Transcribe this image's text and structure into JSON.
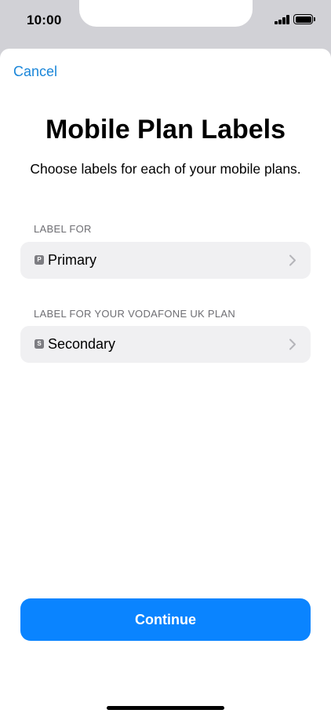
{
  "status_bar": {
    "time": "10:00",
    "icons": [
      "signal-icon",
      "battery-icon"
    ]
  },
  "sheet": {
    "cancel_label": "Cancel",
    "title": "Mobile Plan Labels",
    "subtitle": "Choose labels for each of your mobile plans."
  },
  "plans": [
    {
      "section_label": "LABEL FOR",
      "badge": "P",
      "value": "Primary"
    },
    {
      "section_label": "LABEL FOR YOUR VODAFONE UK PLAN",
      "badge": "S",
      "value": "Secondary"
    }
  ],
  "continue_label": "Continue",
  "colors": {
    "accent": "#0a84ff",
    "link": "#1a86d9",
    "row_bg": "#f0f0f2",
    "secondary_text": "#6e6e73"
  }
}
